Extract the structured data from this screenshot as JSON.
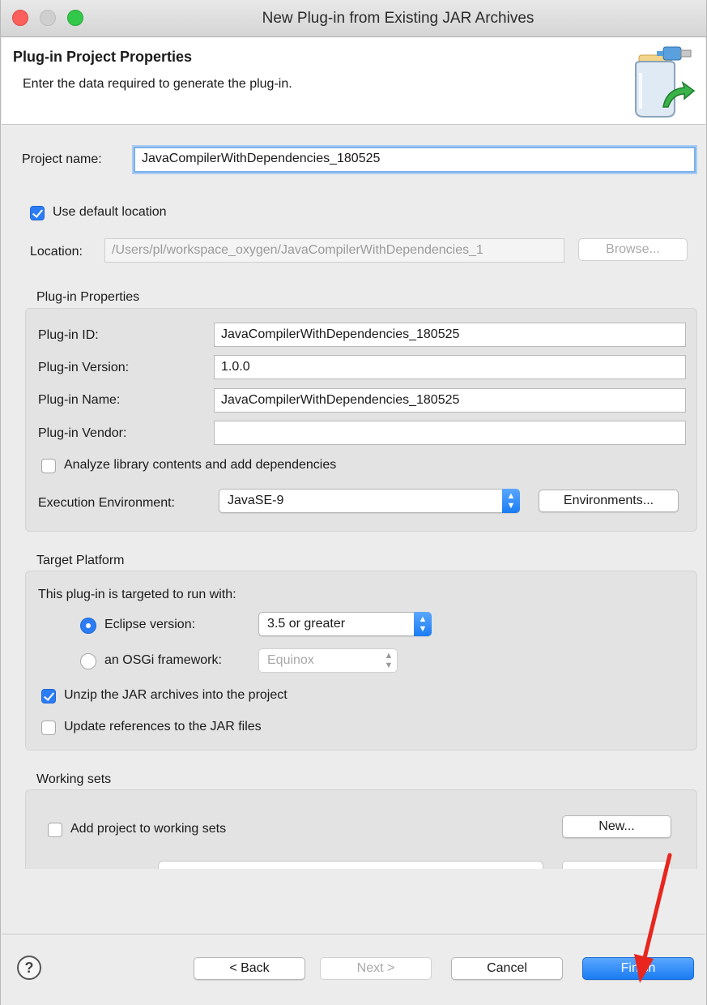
{
  "window": {
    "title": "New Plug-in from Existing JAR Archives"
  },
  "header": {
    "title": "Plug-in Project Properties",
    "subtitle": "Enter the data required to generate the plug-in.",
    "icon": "jar-plugin-icon"
  },
  "project": {
    "name_label": "Project name:",
    "name_value": "JavaCompilerWithDependencies_180525",
    "use_default_label": "Use default location",
    "use_default_checked": true,
    "location_label": "Location:",
    "location_value": "/Users/pl/workspace_oxygen/JavaCompilerWithDependencies_1",
    "browse_label": "Browse..."
  },
  "plugin_properties": {
    "title": "Plug-in Properties",
    "id_label": "Plug-in ID:",
    "id_value": "JavaCompilerWithDependencies_180525",
    "version_label": "Plug-in Version:",
    "version_value": "1.0.0",
    "name_label": "Plug-in Name:",
    "name_value": "JavaCompilerWithDependencies_180525",
    "vendor_label": "Plug-in Vendor:",
    "vendor_value": "",
    "analyze_label": "Analyze library contents and add dependencies",
    "analyze_checked": false,
    "exec_env_label": "Execution Environment:",
    "exec_env_value": "JavaSE-9",
    "environments_label": "Environments..."
  },
  "target_platform": {
    "title": "Target Platform",
    "targeted_label": "This plug-in is targeted to run with:",
    "eclipse_label": "Eclipse version:",
    "eclipse_selected": true,
    "eclipse_value": "3.5 or greater",
    "osgi_label": "an OSGi framework:",
    "osgi_value": "Equinox",
    "unzip_label": "Unzip the JAR archives into the project",
    "unzip_checked": true,
    "update_label": "Update references to the JAR files",
    "update_checked": false
  },
  "working_sets": {
    "title": "Working sets",
    "add_label": "Add project to working sets",
    "add_checked": false,
    "new_label": "New..."
  },
  "footer": {
    "help": "?",
    "back_label": "< Back",
    "next_label": "Next >",
    "cancel_label": "Cancel",
    "finish_label": "Finish"
  },
  "colors": {
    "accent": "#2c7cf6",
    "annotation_arrow": "#e8261e"
  }
}
